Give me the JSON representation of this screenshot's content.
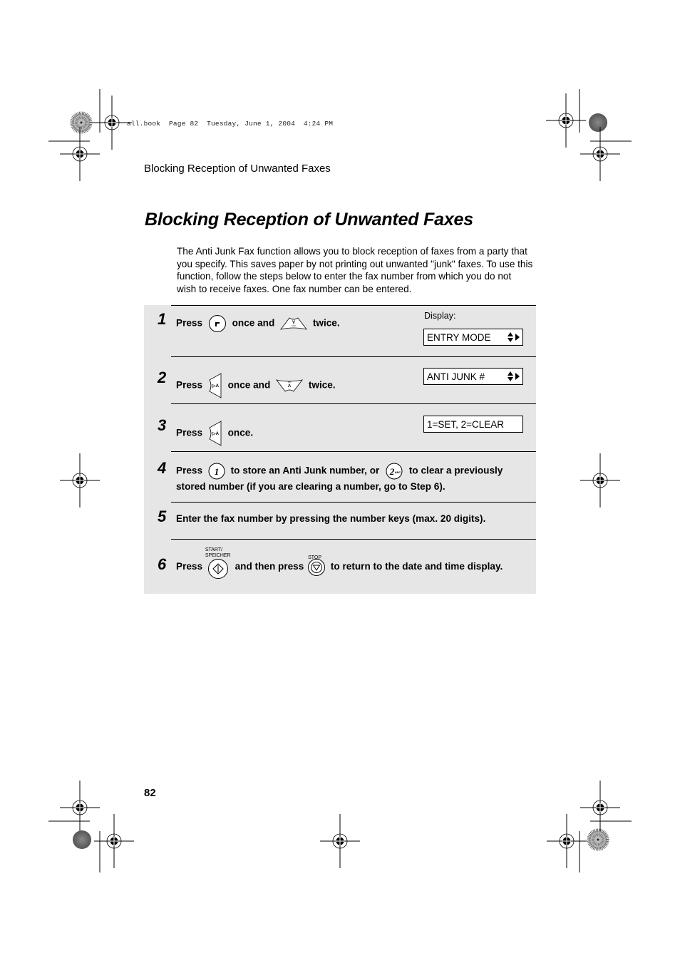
{
  "print_header": "all.book  Page 82  Tuesday, June 1, 2004  4:24 PM",
  "running_head": "Blocking Reception of Unwanted Faxes",
  "title": "Blocking Reception of Unwanted Faxes",
  "intro": "The Anti Junk Fax function allows you to block reception of faxes from a party that you specify. This saves paper by not printing out unwanted \"junk\" faxes. To use this function, follow the steps below to enter the fax number from which you do not wish to receive faxes. One fax number can be entered.",
  "display_label": "Display:",
  "steps": [
    {
      "number": "1",
      "parts": [
        "Press",
        "once and",
        "twice."
      ],
      "icons": [
        "function-key-icon",
        "down-arrow-key-icon"
      ],
      "display": "ENTRY MODE"
    },
    {
      "number": "2",
      "parts": [
        "Press",
        "once and",
        "twice."
      ],
      "icons": [
        "right-arrow-key-icon",
        "up-arrow-key-icon"
      ],
      "display": "ANTI JUNK #"
    },
    {
      "number": "3",
      "parts": [
        "Press",
        "once."
      ],
      "icons": [
        "right-arrow-key-icon"
      ],
      "display": "1=SET, 2=CLEAR"
    },
    {
      "number": "4",
      "parts": [
        "Press",
        "to store an Anti Junk number, or",
        "to clear a previously",
        "stored number (if you are clearing a number, go to Step 6)."
      ],
      "icons": [
        "key-1-icon",
        "key-2-abc-icon"
      ],
      "key_labels": [
        "1",
        "2",
        "ABC"
      ]
    },
    {
      "number": "5",
      "text": "Enter the fax number by pressing the number keys (max. 20 digits)."
    },
    {
      "number": "6",
      "parts": [
        "Press",
        "and then press",
        "to return to the date and time display."
      ],
      "icons": [
        "start-key-icon",
        "stop-key-icon"
      ],
      "key_captions": [
        "START/",
        "SPEICHER",
        "STOP"
      ]
    }
  ],
  "page_number": "82",
  "colors": {
    "step_background": "#e6e6e6",
    "text": "#000000"
  }
}
